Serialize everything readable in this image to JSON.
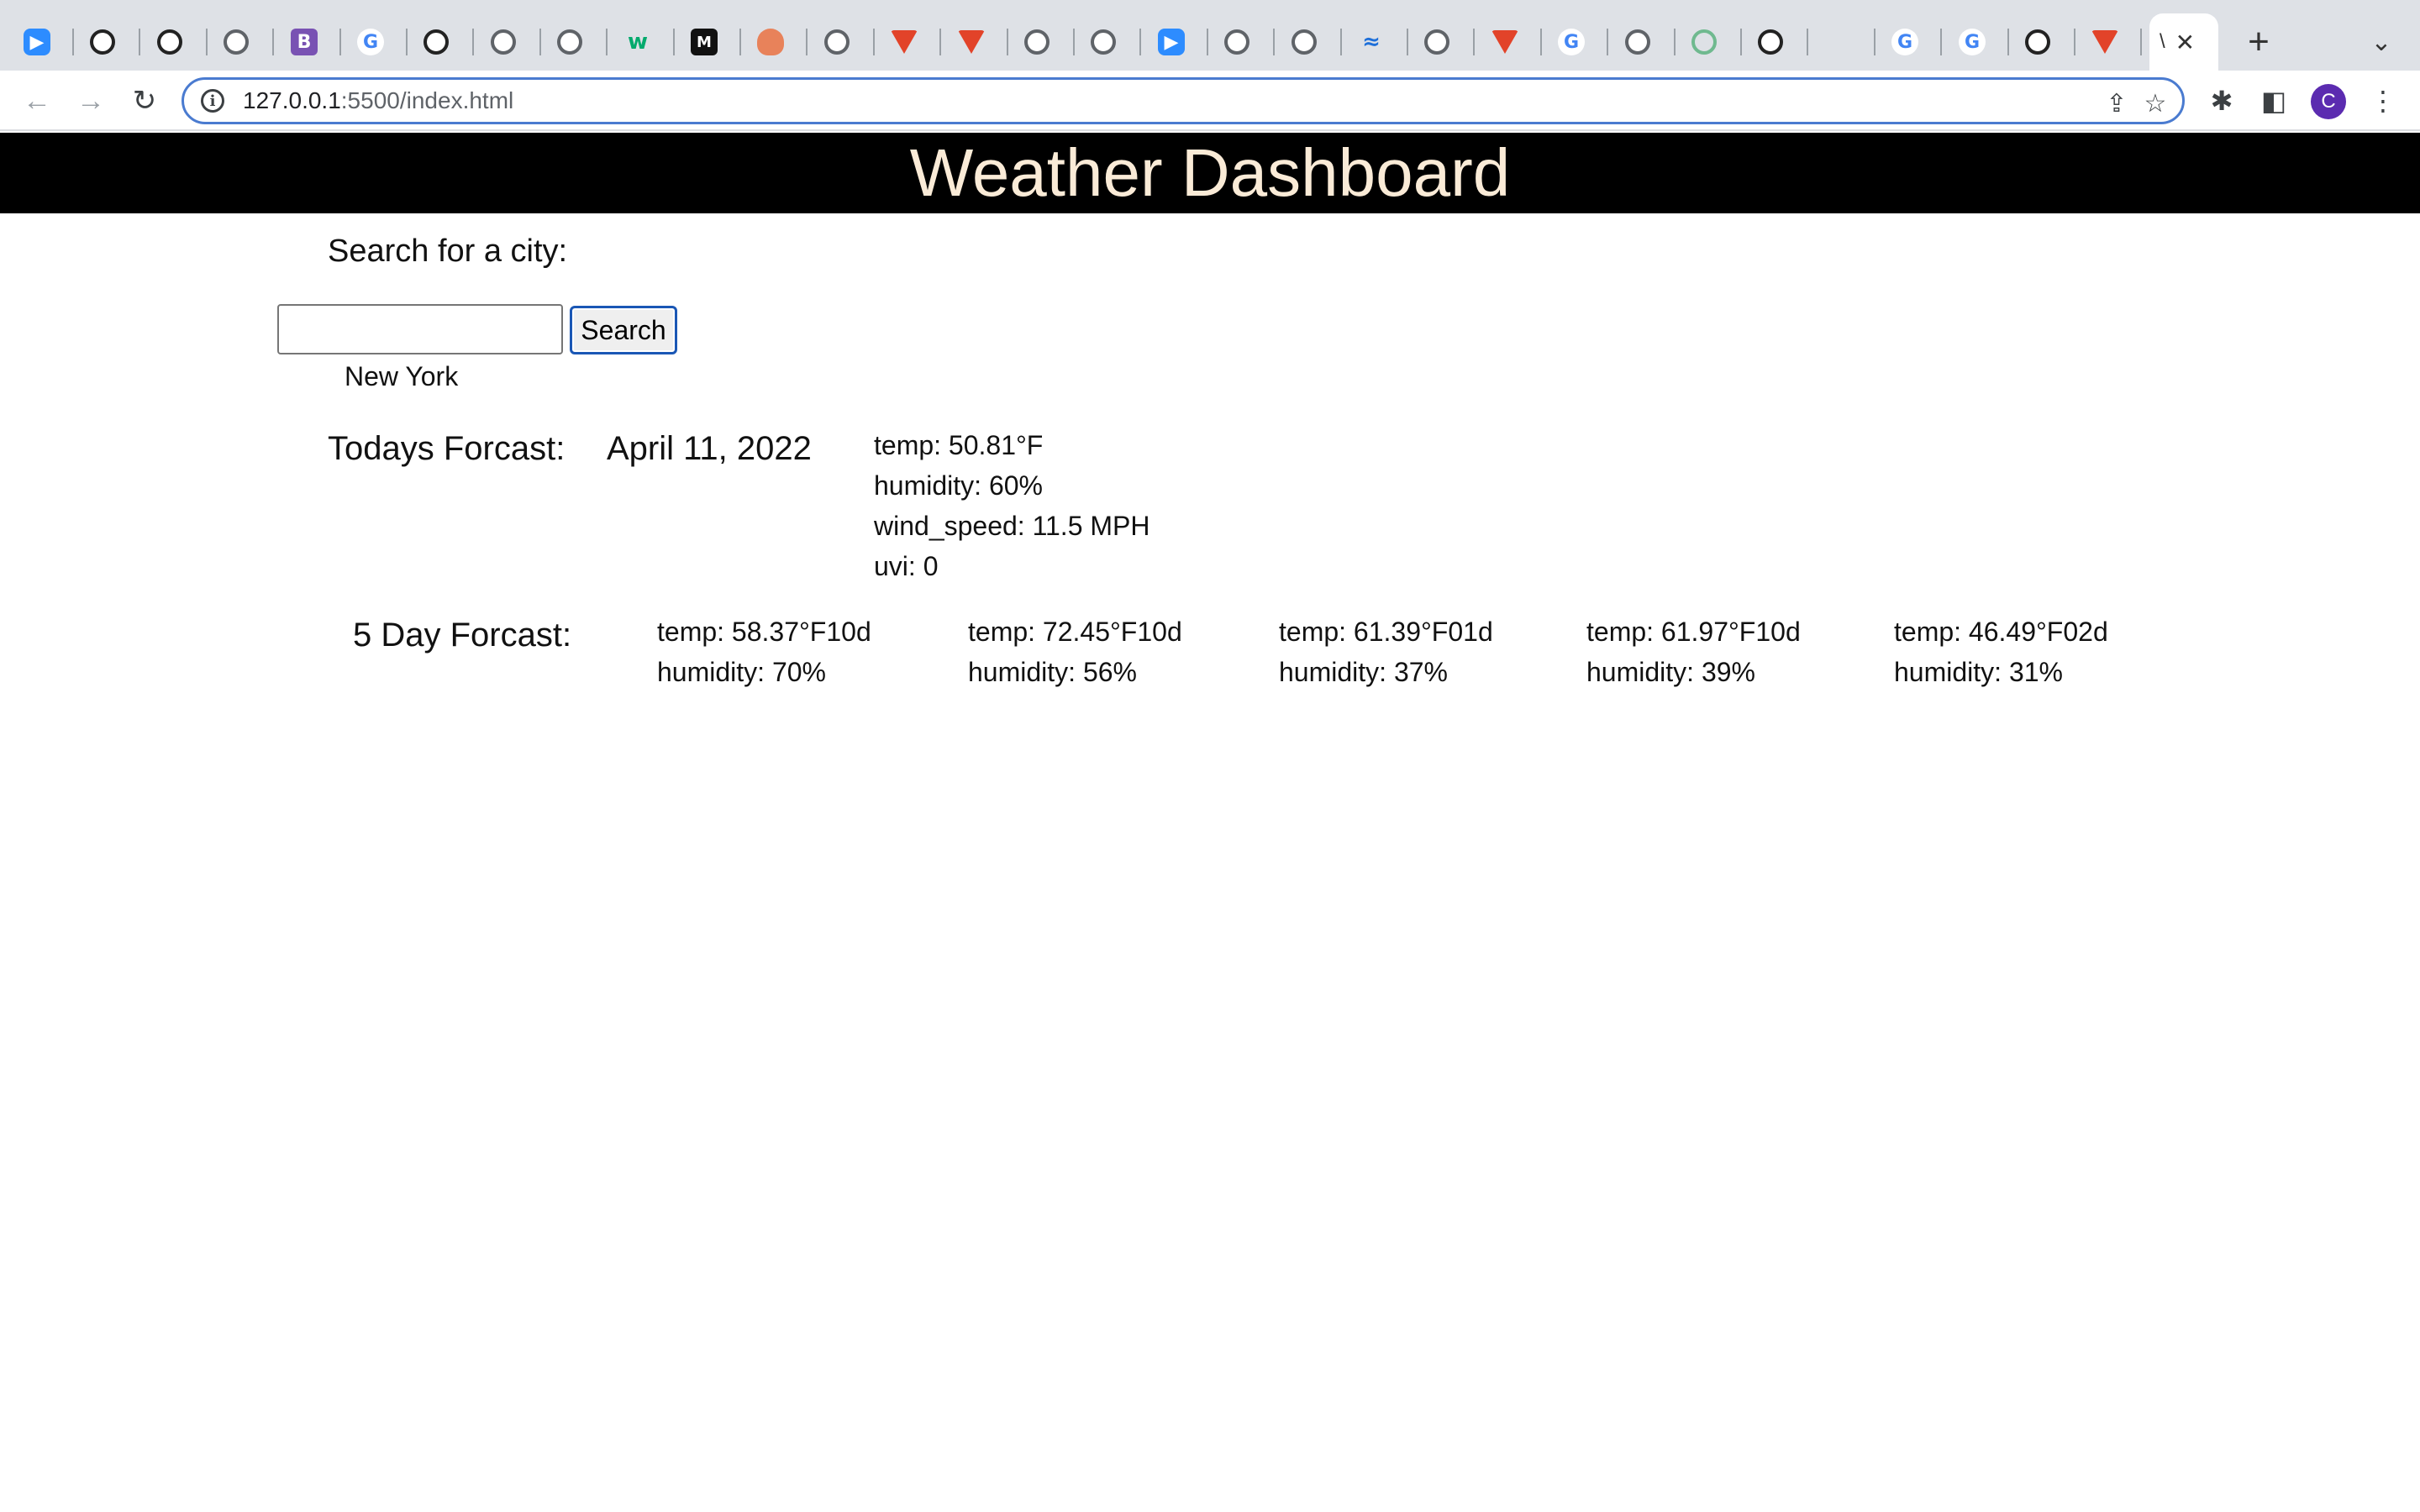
{
  "browser": {
    "tabs": [
      {
        "icon": "zoom-icon"
      },
      {
        "icon": "github-icon"
      },
      {
        "icon": "github-icon"
      },
      {
        "icon": "globe-icon"
      },
      {
        "icon": "bootstrap-icon"
      },
      {
        "icon": "google-icon"
      },
      {
        "icon": "github-icon"
      },
      {
        "icon": "globe-icon"
      },
      {
        "icon": "globe-icon"
      },
      {
        "icon": "w3schools-icon"
      },
      {
        "icon": "m-icon"
      },
      {
        "icon": "cloud-icon"
      },
      {
        "icon": "globe-icon"
      },
      {
        "icon": "gitlab-icon"
      },
      {
        "icon": "gitlab-icon"
      },
      {
        "icon": "globe-icon"
      },
      {
        "icon": "globe-icon"
      },
      {
        "icon": "zoom-icon"
      },
      {
        "icon": "globe-icon"
      },
      {
        "icon": "globe-icon"
      },
      {
        "icon": "wave-icon"
      },
      {
        "icon": "globe-icon"
      },
      {
        "icon": "gitlab-icon"
      },
      {
        "icon": "google-icon"
      },
      {
        "icon": "globe-icon"
      },
      {
        "icon": "clock-icon"
      },
      {
        "icon": "github-icon"
      },
      {
        "icon": "microsoft-icon"
      },
      {
        "icon": "google-icon"
      },
      {
        "icon": "google-icon"
      },
      {
        "icon": "github-icon"
      },
      {
        "icon": "gitlab-icon"
      }
    ],
    "active_tab": {
      "title": "\\"
    },
    "url_host": "127.0.0.1",
    "url_path": ":5500/index.html",
    "profile_initial": "C"
  },
  "app": {
    "title": "Weather Dashboard",
    "search_label": "Search for a city:",
    "search_input_value": "",
    "search_button": "Search",
    "history": [
      "New York"
    ],
    "today_label": "Todays Forcast:",
    "today_date": "April 11, 2022",
    "today_stats": {
      "temp": "temp: 50.81°F",
      "humidity": "humidity: 60%",
      "wind": "wind_speed: 11.5 MPH",
      "uvi": "uvi: 0"
    },
    "five_day_label": "5 Day Forcast:",
    "forecast": [
      {
        "temp": "temp: 58.37°F10d",
        "humidity": "humidity: 70%"
      },
      {
        "temp": "temp: 72.45°F10d",
        "humidity": "humidity: 56%"
      },
      {
        "temp": "temp: 61.39°F01d",
        "humidity": "humidity: 37%"
      },
      {
        "temp": "temp: 61.97°F10d",
        "humidity": "humidity: 39%"
      },
      {
        "temp": "temp: 46.49°F02d",
        "humidity": "humidity: 31%"
      }
    ]
  },
  "colors": {
    "header_bg": "#000000",
    "header_text": "#faebd7",
    "focus_ring": "#1a57b5"
  }
}
